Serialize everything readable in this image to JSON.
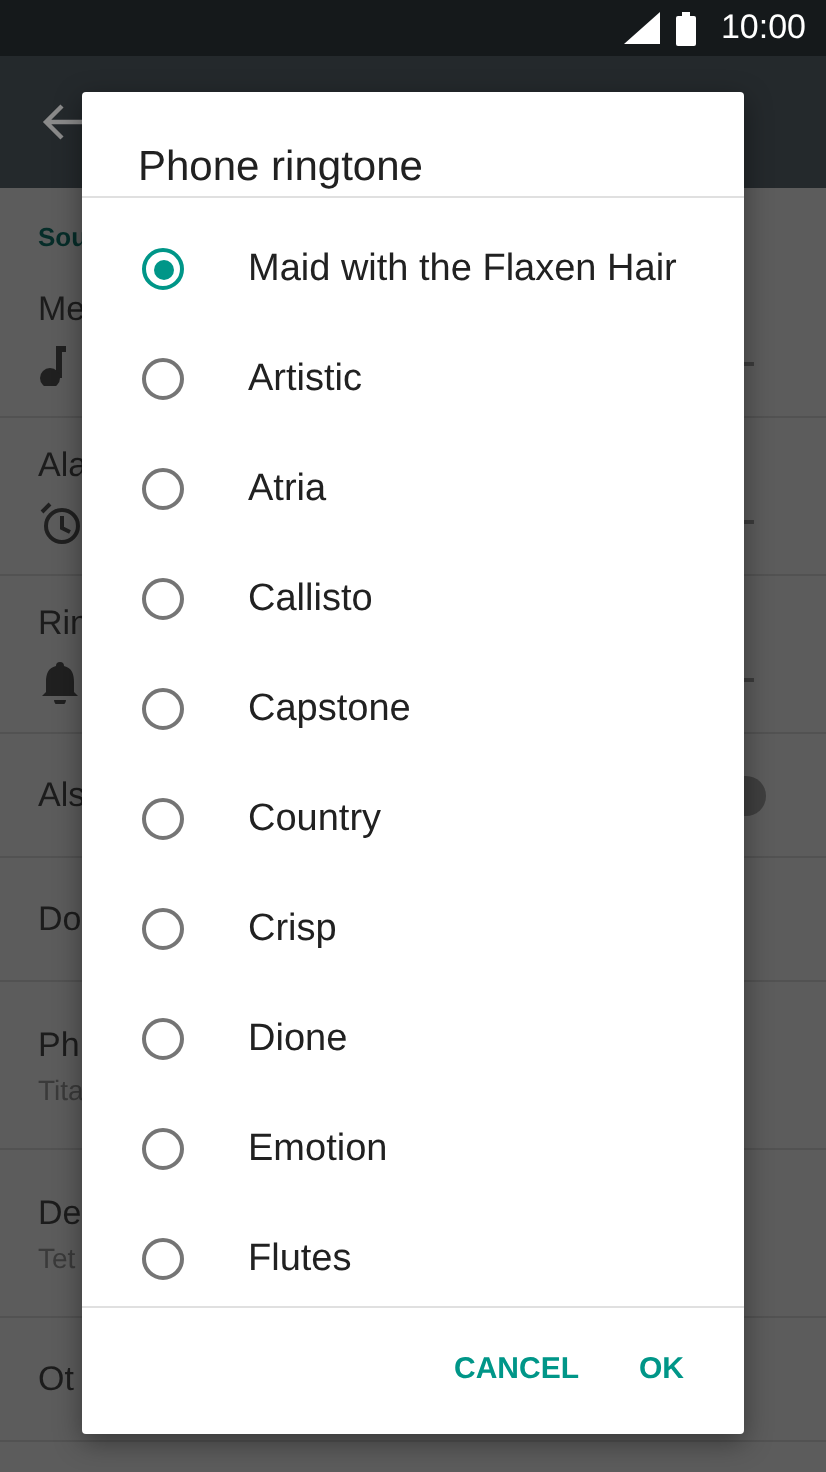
{
  "status_bar": {
    "time": "10:00"
  },
  "background": {
    "section": "Sou",
    "rows": [
      {
        "kind": "icon",
        "title": "Me"
      },
      {
        "kind": "icon",
        "title": "Ala"
      },
      {
        "kind": "icon",
        "title": "Rin"
      },
      {
        "kind": "toggle",
        "title": "Als",
        "on": false
      },
      {
        "kind": "text",
        "title": "Do"
      },
      {
        "kind": "subtitle",
        "title": "Ph",
        "subtitle": "Tita"
      },
      {
        "kind": "subtitle",
        "title": "De",
        "subtitle": "Tet"
      },
      {
        "kind": "text",
        "title": "Ot"
      }
    ]
  },
  "dialog": {
    "title": "Phone ringtone",
    "options": [
      {
        "label": "Maid with the Flaxen Hair",
        "selected": true
      },
      {
        "label": "Artistic",
        "selected": false
      },
      {
        "label": "Atria",
        "selected": false
      },
      {
        "label": "Callisto",
        "selected": false
      },
      {
        "label": "Capstone",
        "selected": false
      },
      {
        "label": "Country",
        "selected": false
      },
      {
        "label": "Crisp",
        "selected": false
      },
      {
        "label": "Dione",
        "selected": false
      },
      {
        "label": "Emotion",
        "selected": false
      },
      {
        "label": "Flutes",
        "selected": false
      }
    ],
    "buttons": [
      "CANCEL",
      "OK"
    ]
  }
}
